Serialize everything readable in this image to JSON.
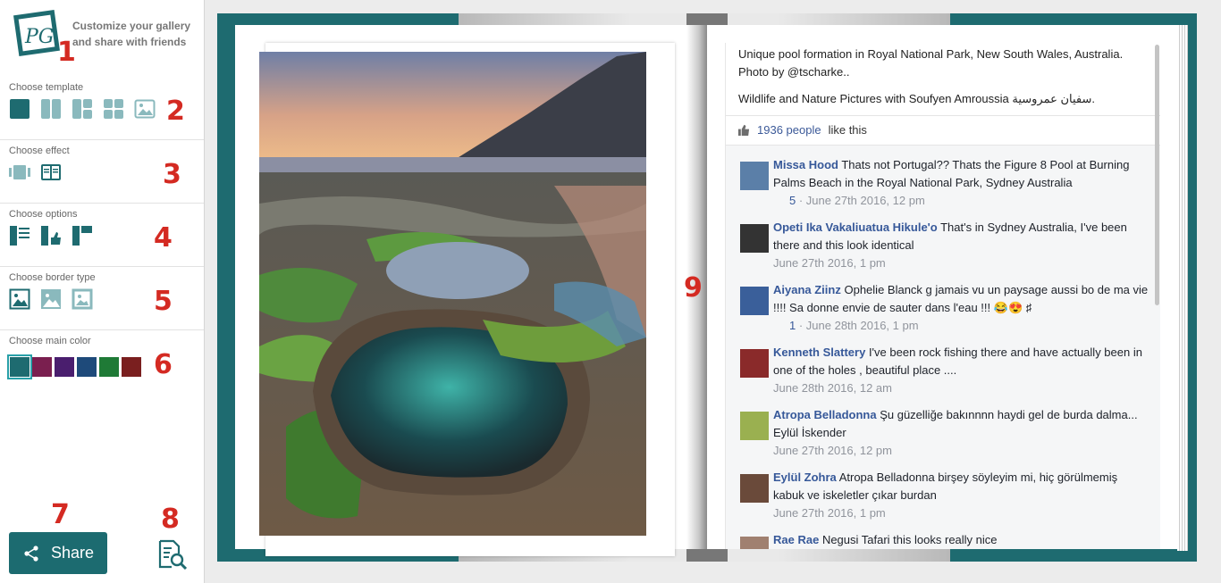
{
  "sidebar": {
    "logo_text": "PG",
    "tagline": "Customize your gallery and share with friends",
    "numbers": [
      "1",
      "2",
      "3",
      "4",
      "5",
      "6",
      "7",
      "8",
      "9"
    ],
    "sections": {
      "template": "Choose template",
      "effect": "Choose effect",
      "options": "Choose options",
      "border": "Choose border type",
      "color": "Choose main color"
    },
    "colors": [
      "#1e6b70",
      "#7a1f4f",
      "#4a1e6e",
      "#1e4a7a",
      "#1f7a36",
      "#7a1f1f"
    ],
    "selected_color": "#1e6b70",
    "share_label": "Share"
  },
  "post": {
    "description_1": "Unique pool formation in Royal National Park, New South Wales, Australia. Photo by @tscharke..",
    "description_2": "Wildlife and Nature Pictures with Soufyen Amroussia سفيان عمروسية.",
    "likes_count": "1936 people",
    "likes_suffix": "like this"
  },
  "comments": [
    {
      "author": "Missa Hood",
      "text": "Thats not Portugal?? Thats the Figure 8 Pool at Burning Palms Beach in the Royal National Park, Sydney Australia",
      "likes": "5",
      "date": "· June 27th 2016, 12 pm",
      "avatar_color": "#5b7fa8"
    },
    {
      "author": "Opeti Ika Vakaliuatua Hikule'o",
      "text": "That's in Sydney Australia, I've been there and this look identical",
      "likes": "",
      "date": "June 27th 2016, 1 pm",
      "avatar_color": "#333333"
    },
    {
      "author": "Aiyana Ziinz",
      "text": "Ophelie Blanck g jamais vu un paysage aussi bo de ma vie !!!! Sa donne envie de sauter dans l'eau !!! 😂😍 ♯",
      "likes": "1",
      "date": "· June 28th 2016, 1 pm",
      "avatar_color": "#3a5f9a"
    },
    {
      "author": "Kenneth Slattery",
      "text": "I've been rock fishing there and have actually been in one of the holes , beautiful place ....",
      "likes": "",
      "date": "June 28th 2016, 12 am",
      "avatar_color": "#8a2a2a"
    },
    {
      "author": "Atropa Belladonna",
      "text": "Şu güzelliğe bakınnnn haydi gel de burda dalma... Eylül İskender",
      "likes": "",
      "date": "June 27th 2016, 12 pm",
      "avatar_color": "#9ab050"
    },
    {
      "author": "Eylül Zohra",
      "text": "Atropa Belladonna birşey söyleyim mi, hiç görülmemiş kabuk ve iskeletler çıkar burdan",
      "likes": "",
      "date": "June 27th 2016, 1 pm",
      "avatar_color": "#6a4a3a"
    },
    {
      "author": "Rae Rae",
      "text": "Negusi Tafari this looks really nice",
      "likes": "",
      "date": "",
      "avatar_color": "#a08070"
    }
  ]
}
